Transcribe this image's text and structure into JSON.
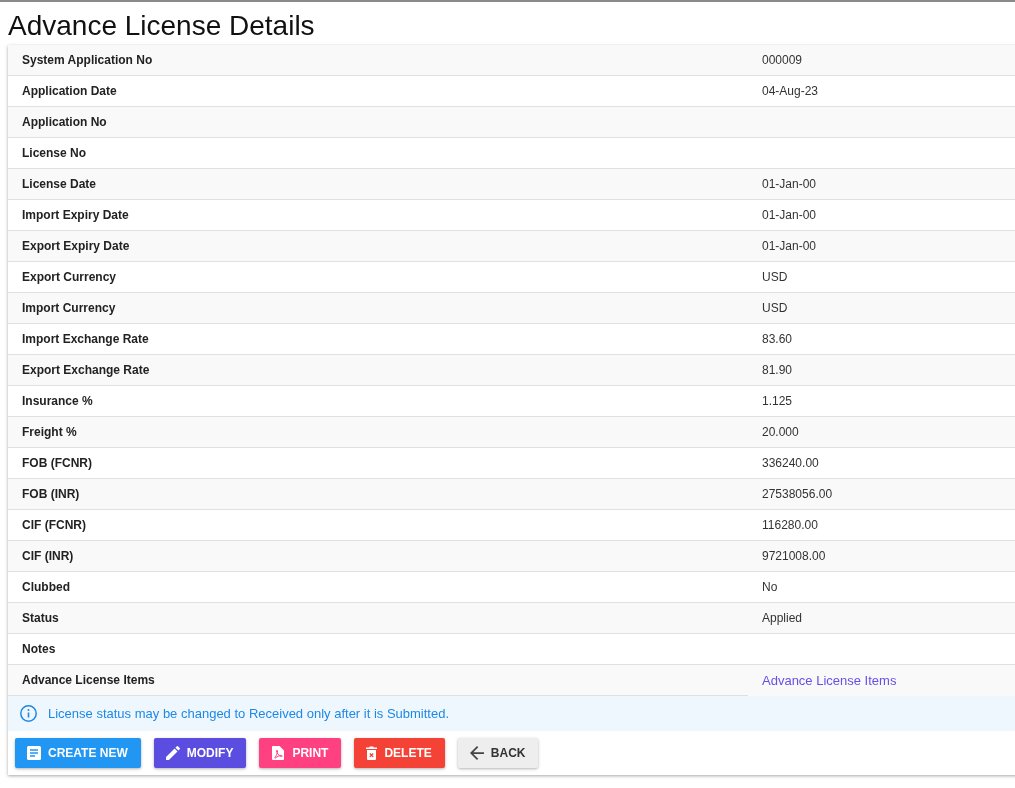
{
  "page": {
    "title": "Advance License Details"
  },
  "details": {
    "rows": [
      {
        "label": "System Application No",
        "value": "000009",
        "kind": "text"
      },
      {
        "label": "Application Date",
        "value": "04-Aug-23",
        "kind": "text"
      },
      {
        "label": "Application No",
        "kind": "text"
      },
      {
        "label": "License No",
        "kind": "text"
      },
      {
        "label": "License Date",
        "value": "01-Jan-00",
        "kind": "text"
      },
      {
        "label": "Import Expiry Date",
        "value": "01-Jan-00",
        "kind": "text"
      },
      {
        "label": "Export Expiry Date",
        "value": "01-Jan-00",
        "kind": "text"
      },
      {
        "label": "Export Currency",
        "value": "USD",
        "kind": "text"
      },
      {
        "label": "Import Currency",
        "value": "USD",
        "kind": "text"
      },
      {
        "label": "Import Exchange Rate",
        "value": "83.60",
        "kind": "text"
      },
      {
        "label": "Export Exchange Rate",
        "value": "81.90",
        "kind": "text"
      },
      {
        "label": "Insurance %",
        "value": "1.125",
        "kind": "text"
      },
      {
        "label": "Freight %",
        "value": "20.000",
        "kind": "text"
      },
      {
        "label": "FOB (FCNR)",
        "value": "336240.00",
        "kind": "text"
      },
      {
        "label": "FOB (INR)",
        "value": "27538056.00",
        "kind": "text"
      },
      {
        "label": "CIF (FCNR)",
        "value": "116280.00",
        "kind": "text"
      },
      {
        "label": "CIF (INR)",
        "value": "9721008.00",
        "kind": "text"
      },
      {
        "label": "Clubbed",
        "value": "No",
        "kind": "text"
      },
      {
        "label": "Status",
        "value": "Applied",
        "kind": "text"
      },
      {
        "label": "Notes",
        "kind": "text"
      },
      {
        "label": "Advance License Items",
        "value": "Advance License Items",
        "kind": "link"
      }
    ]
  },
  "alert": {
    "kind": "info",
    "text": "License status may be changed to Received only after it is Submitted."
  },
  "buttons": [
    {
      "label": "CREATE NEW",
      "kind": "create"
    },
    {
      "label": "MODIFY",
      "kind": "modify"
    },
    {
      "label": "PRINT",
      "kind": "print"
    },
    {
      "label": "DELETE",
      "kind": "delete"
    },
    {
      "label": "BACK",
      "kind": "back"
    }
  ]
}
